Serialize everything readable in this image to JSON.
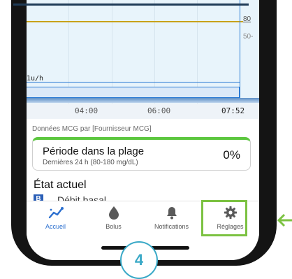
{
  "chart": {
    "y_labels": [
      "80",
      "50-"
    ],
    "basal_label": "1u/h",
    "x_ticks": [
      "04:00",
      "06:00",
      "07:52"
    ]
  },
  "source_text": "Données MCG par [Fournisseur MCG]",
  "tir_card": {
    "title": "Période dans la plage",
    "subtitle": "Dernières 24 h (80-180 mg/dL)",
    "value": "0%",
    "accent_color": "#5cc73f"
  },
  "current_state": {
    "title": "État actuel",
    "basal_badge": "B",
    "basal_label": "Débit basal"
  },
  "nav": {
    "items": [
      {
        "label": "Accueil",
        "icon": "home-trend-icon",
        "active": true
      },
      {
        "label": "Bolus",
        "icon": "drop-icon",
        "active": false
      },
      {
        "label": "Notifications",
        "icon": "bell-icon",
        "active": false
      },
      {
        "label": "Réglages",
        "icon": "gear-icon",
        "active": false
      }
    ]
  },
  "callout": {
    "step": "4",
    "highlight_color": "#7cc242",
    "step_color": "#3aa9c7"
  }
}
